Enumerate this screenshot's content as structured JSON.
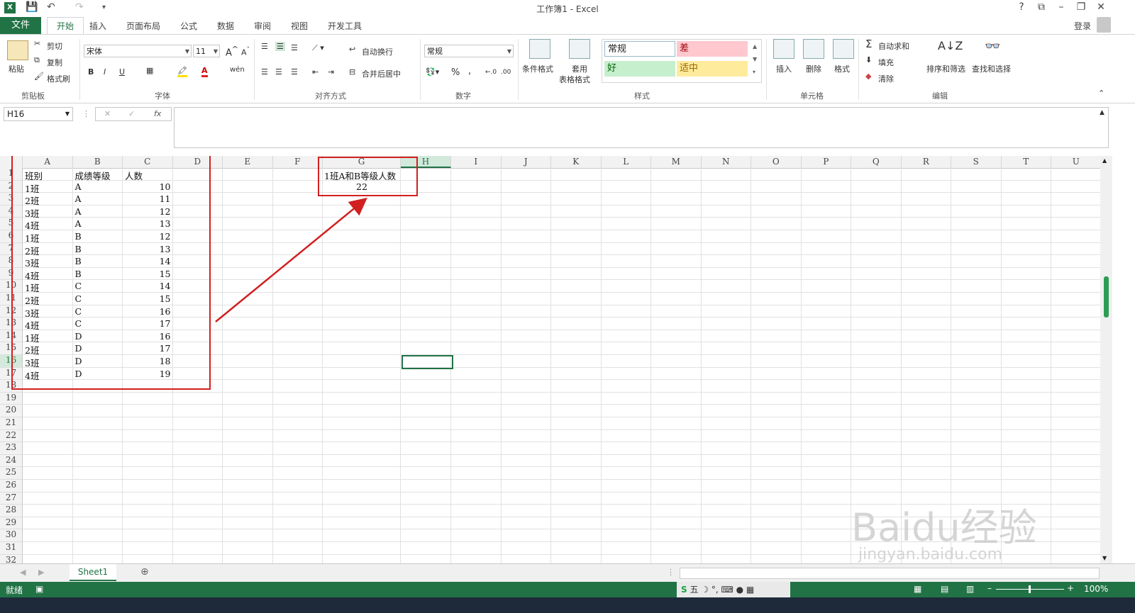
{
  "window": {
    "title": "工作簿1 - Excel",
    "help": "?",
    "login": "登录"
  },
  "tabs": {
    "file": "文件",
    "home": "开始",
    "insert": "插入",
    "layout": "页面布局",
    "formulas": "公式",
    "data": "数据",
    "review": "审阅",
    "view": "视图",
    "developer": "开发工具"
  },
  "ribbon": {
    "clipboard": {
      "paste": "粘贴",
      "cut": "剪切",
      "copy": "复制",
      "painter": "格式刷",
      "label": "剪贴板"
    },
    "font": {
      "name": "宋体",
      "size": "11",
      "bold": "B",
      "italic": "I",
      "underline": "U",
      "label": "字体"
    },
    "alignment": {
      "wrap": "自动换行",
      "merge": "合并后居中",
      "label": "对齐方式"
    },
    "number": {
      "format": "常规",
      "label": "数字"
    },
    "styles": {
      "conditional": "条件格式",
      "table_1": "套用",
      "table_2": "表格格式",
      "normal": "常规",
      "bad": "差",
      "good": "好",
      "neutral": "适中",
      "label": "样式"
    },
    "cells": {
      "insert": "插入",
      "delete": "删除",
      "format": "格式",
      "label": "单元格"
    },
    "editing": {
      "autosum": "自动求和",
      "fill": "填充",
      "clear": "清除",
      "sort": "排序和筛选",
      "find": "查找和选择",
      "label": "编辑"
    }
  },
  "formula_bar": {
    "name_box": "H16",
    "formula": ""
  },
  "columns": [
    "A",
    "B",
    "C",
    "D",
    "E",
    "F",
    "G",
    "H",
    "I",
    "J",
    "K",
    "L",
    "M",
    "N",
    "O",
    "P",
    "Q",
    "R",
    "S",
    "T",
    "U"
  ],
  "rows": [
    "1",
    "2",
    "3",
    "4",
    "5",
    "6",
    "7",
    "8",
    "9",
    "10",
    "11",
    "12",
    "13",
    "14",
    "15",
    "16",
    "17",
    "18",
    "19",
    "20",
    "21",
    "22",
    "23",
    "24",
    "25",
    "26",
    "27",
    "28",
    "29",
    "30",
    "31",
    "32"
  ],
  "table": {
    "headers": [
      "班别",
      "成绩等级",
      "人数"
    ],
    "data": [
      [
        "1班",
        "A",
        "10"
      ],
      [
        "2班",
        "A",
        "11"
      ],
      [
        "3班",
        "A",
        "12"
      ],
      [
        "4班",
        "A",
        "13"
      ],
      [
        "1班",
        "B",
        "12"
      ],
      [
        "2班",
        "B",
        "13"
      ],
      [
        "3班",
        "B",
        "14"
      ],
      [
        "4班",
        "B",
        "15"
      ],
      [
        "1班",
        "C",
        "14"
      ],
      [
        "2班",
        "C",
        "15"
      ],
      [
        "3班",
        "C",
        "16"
      ],
      [
        "4班",
        "C",
        "17"
      ],
      [
        "1班",
        "D",
        "16"
      ],
      [
        "2班",
        "D",
        "17"
      ],
      [
        "3班",
        "D",
        "18"
      ],
      [
        "4班",
        "D",
        "19"
      ]
    ]
  },
  "result": {
    "label": "1班A和B等级人数",
    "value": "22"
  },
  "sheet": {
    "name": "Sheet1"
  },
  "status": {
    "ready": "就绪",
    "zoom": "100%"
  },
  "watermark": {
    "line1": "Baidu经验",
    "line2": "jingyan.baidu.com"
  },
  "colors": {
    "accent": "#217346",
    "annotation": "#d22020"
  }
}
